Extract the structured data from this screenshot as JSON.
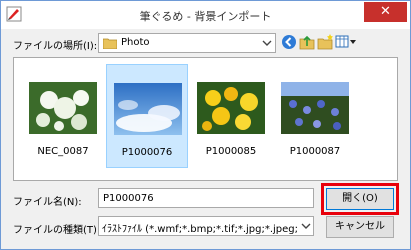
{
  "window": {
    "title": "筆ぐるめ - 背景インポート",
    "close_label": "✕"
  },
  "lookin": {
    "label": "ファイルの場所(I):",
    "value": "Photo"
  },
  "toolbar": {
    "icons": [
      "back-icon",
      "up-folder-icon",
      "new-folder-icon",
      "view-menu-icon"
    ]
  },
  "files": [
    {
      "name": "NEC_0087",
      "selected": false,
      "colors": [
        "#e9f3e0",
        "#5e8c3e",
        "#2f5a20"
      ]
    },
    {
      "name": "P1000076",
      "selected": true,
      "colors": [
        "#ffffff",
        "#4d8fd6",
        "#1f5fb0"
      ]
    },
    {
      "name": "P1000085",
      "selected": false,
      "colors": [
        "#f5d020",
        "#4a7b2b",
        "#1e3d12"
      ]
    },
    {
      "name": "P1000087",
      "selected": false,
      "colors": [
        "#6a7fd0",
        "#3c5c2a",
        "#1c2f14"
      ]
    }
  ],
  "filename": {
    "label": "ファイル名(N):",
    "value": "P1000076"
  },
  "filetype": {
    "label": "ファイルの種類(T):",
    "value": "ｲﾗｽﾄﾌｧｲﾙ (*.wmf;*.bmp;*.tif;*.jpg;*.jpeg;"
  },
  "buttons": {
    "open": "開く(O)",
    "cancel": "キャンセル"
  },
  "colors": {
    "highlight": "#e8000b",
    "selection": "#cce8ff",
    "close": "#c7302c"
  }
}
